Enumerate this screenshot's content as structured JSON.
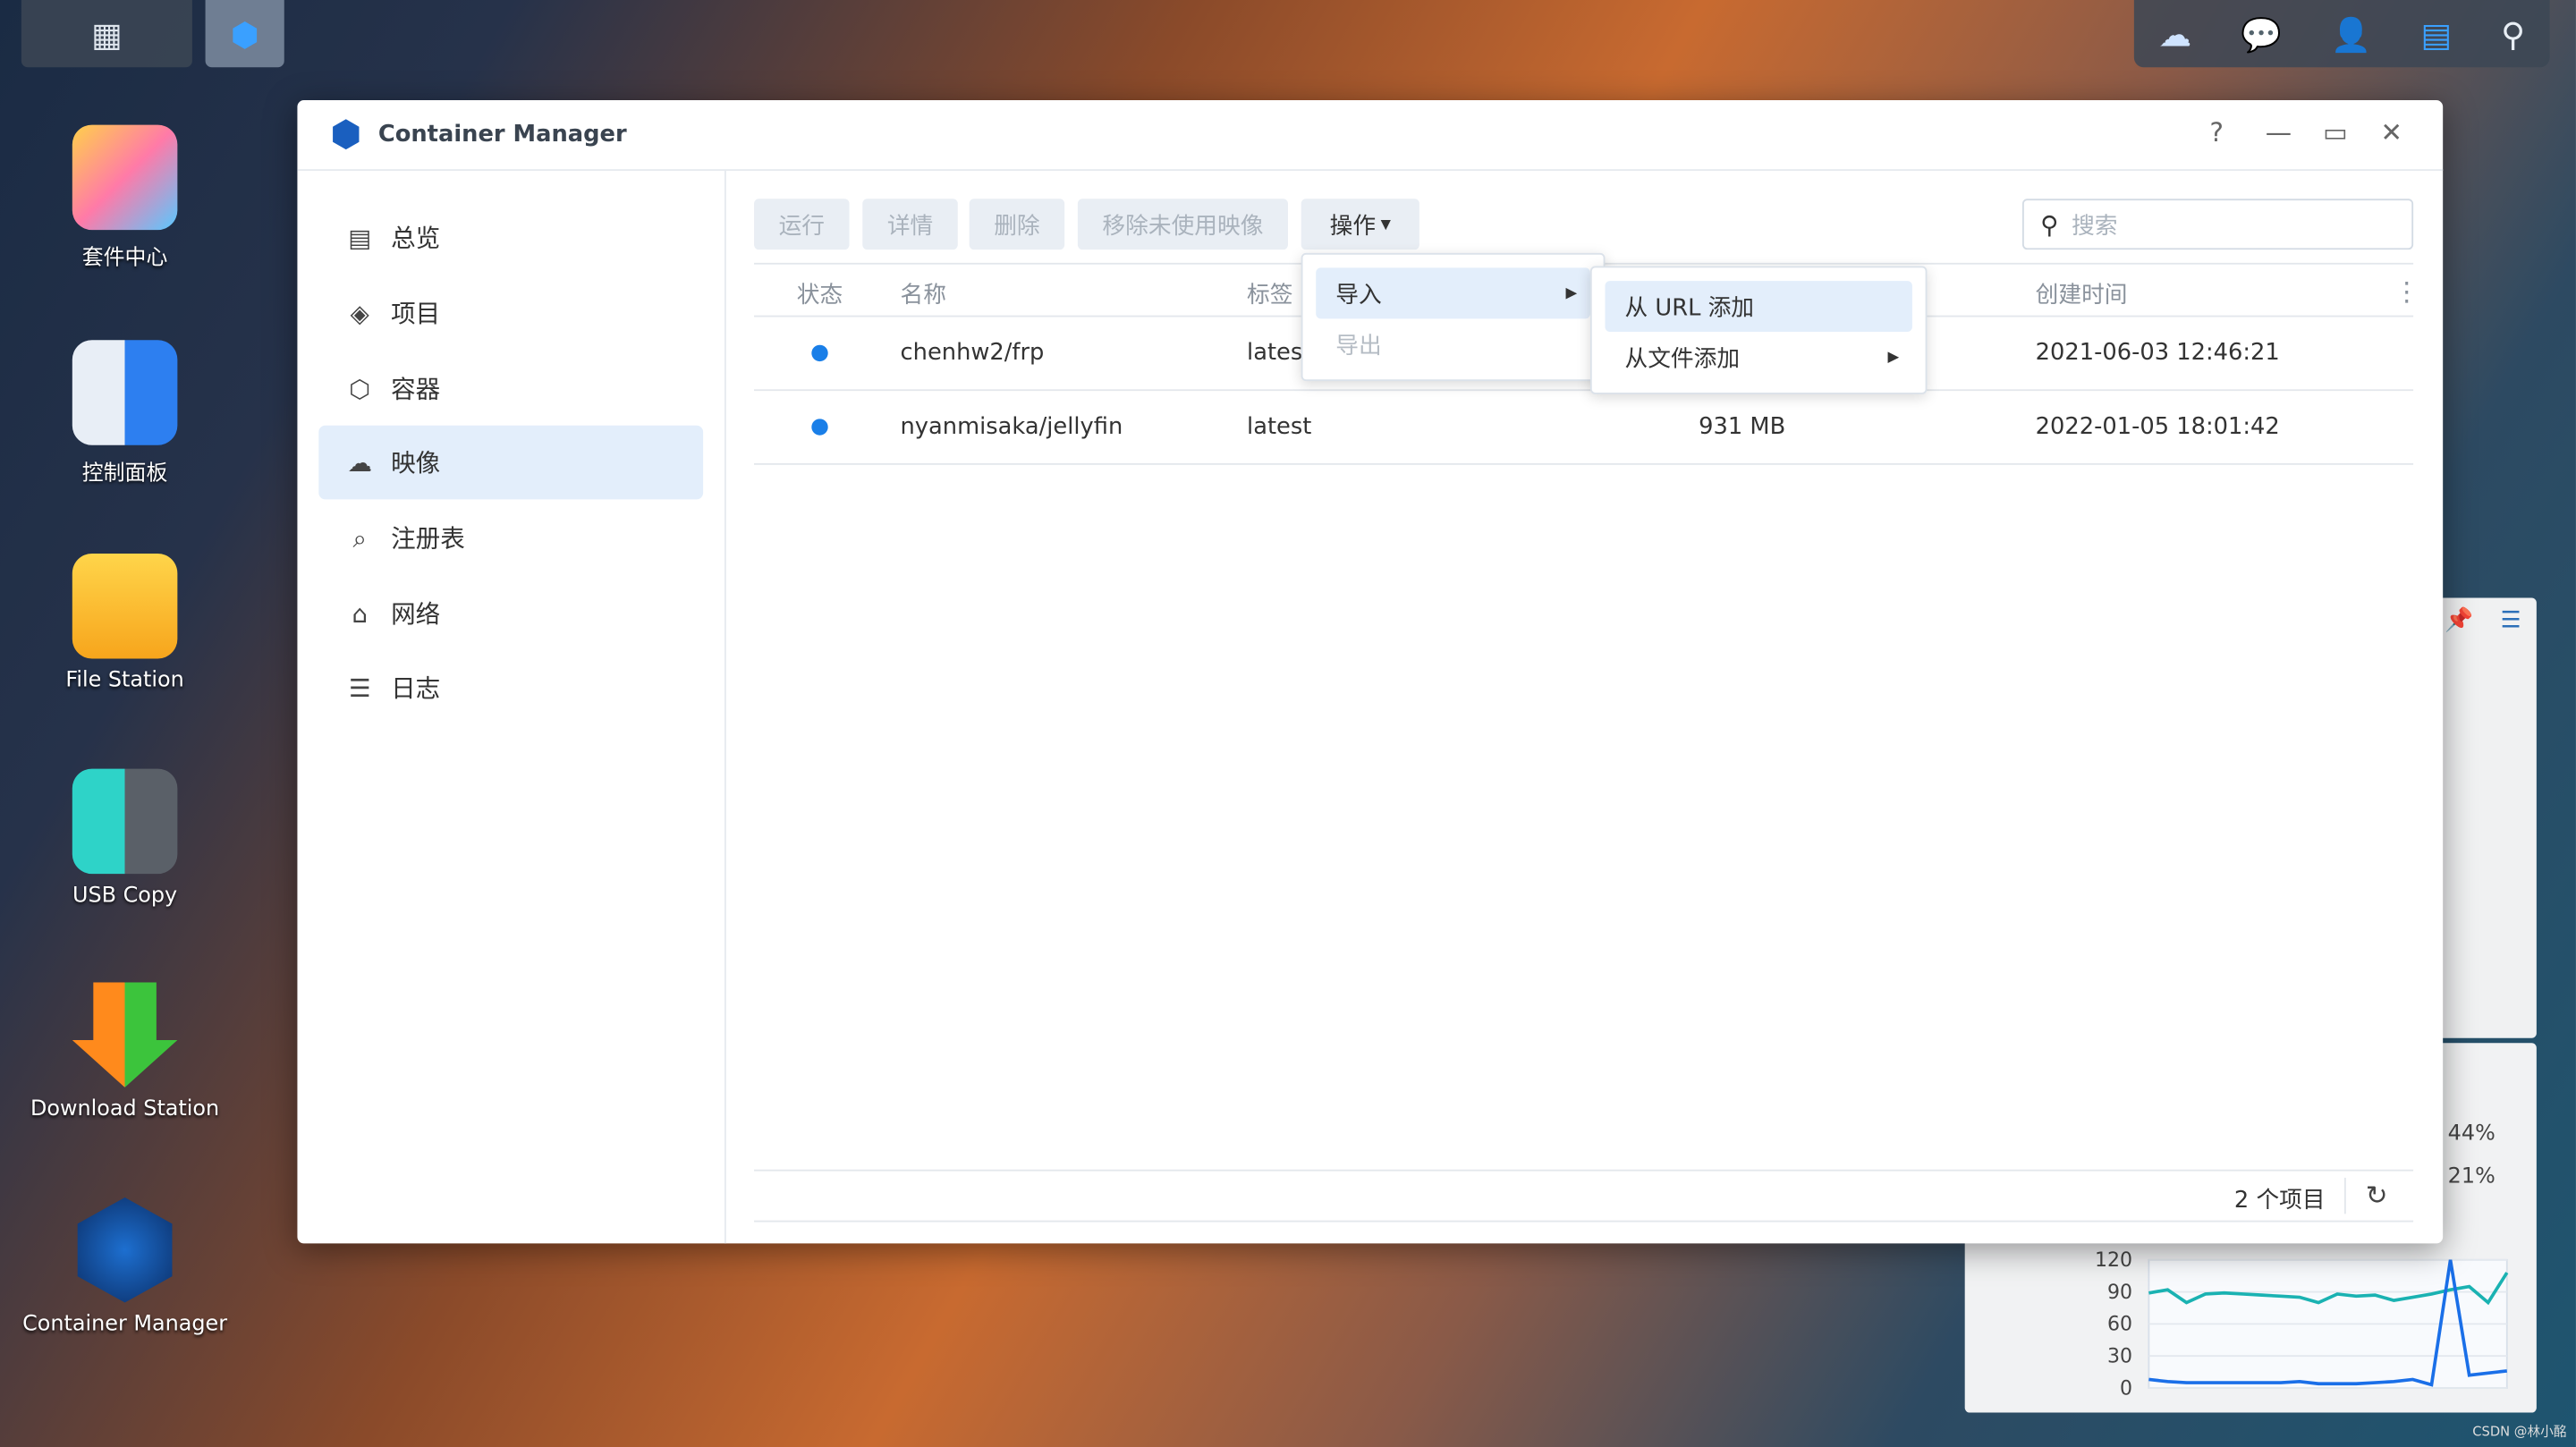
{
  "taskbar": {
    "apps_icon": "grid-icon",
    "active_app_icon": "container-manager-icon",
    "tray_icons": [
      "cloud-sync-icon",
      "chat-icon",
      "user-icon",
      "widgets-icon",
      "search-icon"
    ]
  },
  "desktop": {
    "icons": [
      {
        "label": "套件中心",
        "icon": "package-center-icon"
      },
      {
        "label": "控制面板",
        "icon": "control-panel-icon"
      },
      {
        "label": "File Station",
        "icon": "folder-icon"
      },
      {
        "label": "USB Copy",
        "icon": "usb-copy-icon"
      },
      {
        "label": "Download Station",
        "icon": "download-icon"
      },
      {
        "label": "Container Manager",
        "icon": "container-manager-icon"
      }
    ]
  },
  "window": {
    "title": "Container Manager",
    "help": "?",
    "sidebar": [
      {
        "label": "总览",
        "icon": "overview-icon"
      },
      {
        "label": "项目",
        "icon": "layers-icon"
      },
      {
        "label": "容器",
        "icon": "box-icon"
      },
      {
        "label": "映像",
        "icon": "cloud-icon",
        "active": true
      },
      {
        "label": "注册表",
        "icon": "registry-icon"
      },
      {
        "label": "网络",
        "icon": "network-icon"
      },
      {
        "label": "日志",
        "icon": "list-icon"
      }
    ],
    "toolbar": {
      "run": "运行",
      "details": "详情",
      "delete": "删除",
      "remove_unused": "移除未使用映像",
      "action": "操作"
    },
    "search": {
      "placeholder": "搜索"
    },
    "table": {
      "headers": {
        "status": "状态",
        "name": "名称",
        "tag": "标签",
        "created": "创建时间"
      },
      "rows": [
        {
          "status": "running",
          "name": "chenhw2/frp",
          "tag": "latest",
          "size": "",
          "created": "2021-06-03 12:46:21"
        },
        {
          "status": "running",
          "name": "nyanmisaka/jellyfin",
          "tag": "latest",
          "size": "931 MB",
          "created": "2022-01-05 18:01:42"
        }
      ]
    },
    "action_menu": {
      "items": [
        {
          "label": "导入",
          "enabled": true
        },
        {
          "label": "导出",
          "enabled": false
        }
      ]
    },
    "import_submenu": {
      "items": [
        {
          "label": "从 URL 添加"
        },
        {
          "label": "从文件添加"
        }
      ]
    },
    "footer": {
      "count": "2 个项目"
    }
  },
  "widget": {
    "cpu_percent": "44%",
    "ram_percent": "21%"
  },
  "chart_data": {
    "type": "line",
    "ylim": [
      0,
      120
    ],
    "yticks": [
      "120",
      "90",
      "60",
      "30",
      "0"
    ],
    "series": [
      {
        "color": "#1ab2b2",
        "values": [
          89,
          92,
          80,
          88,
          89,
          88,
          87,
          86,
          85,
          80,
          88,
          86,
          87,
          82,
          85,
          88,
          92,
          95,
          80,
          108
        ]
      },
      {
        "color": "#1a6fe8",
        "values": [
          8,
          6,
          5,
          5,
          5,
          5,
          5,
          5,
          6,
          4,
          4,
          4,
          5,
          6,
          8,
          3,
          122,
          12,
          14,
          16
        ]
      }
    ]
  },
  "watermark": "CSDN @林小酩"
}
